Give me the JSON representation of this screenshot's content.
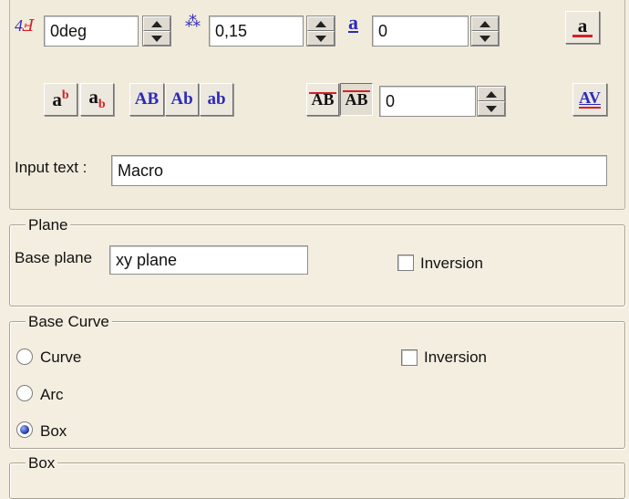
{
  "top": {
    "angle": {
      "icon": "text-angle-icon",
      "value": "0deg"
    },
    "height": {
      "icon": "text-height-icon",
      "value": "0,15"
    },
    "spacing": {
      "icon": "char-spacing-icon",
      "value": "0"
    },
    "kerning": {
      "value": "0"
    },
    "format_buttons": {
      "superscript": "a",
      "superscript_mark": "b",
      "subscript": "a",
      "subscript_mark": "b",
      "upper_case": "AB",
      "title_case": "Ab",
      "lower_case": "ab",
      "strike": "AB",
      "overline": "AB",
      "underline_color": "a",
      "kerning_av": "AV"
    },
    "input_label": "Input text :",
    "input_value": "Macro"
  },
  "plane": {
    "title": "Plane",
    "base_label": "Base plane",
    "base_value": "xy plane",
    "inversion_label": "Inversion",
    "inversion_checked": false
  },
  "base_curve": {
    "title": "Base Curve",
    "options": [
      {
        "label": "Curve",
        "selected": false
      },
      {
        "label": "Arc",
        "selected": false
      },
      {
        "label": "Box",
        "selected": true
      }
    ],
    "inversion_label": "Inversion",
    "inversion_checked": false
  },
  "box": {
    "title": "Box"
  },
  "colors": {
    "accent_red": "#d4202a",
    "accent_blue": "#2c2ab8"
  }
}
